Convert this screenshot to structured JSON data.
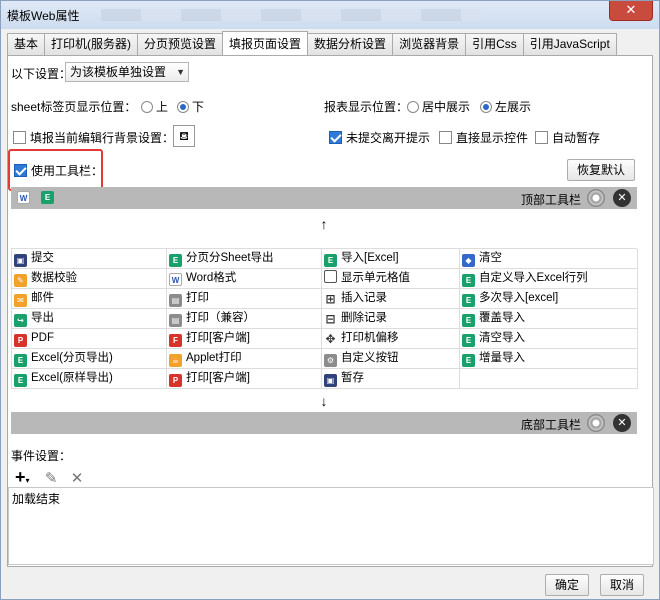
{
  "window": {
    "title": "模板Web属性",
    "close_label": "✕"
  },
  "tabs": [
    "基本",
    "打印机(服务器)",
    "分页预览设置",
    "填报页面设置",
    "数据分析设置",
    "浏览器背景",
    "引用Css",
    "引用JavaScript"
  ],
  "settings": {
    "scope_label": "以下设置：",
    "scope_value": "为该模板单独设置",
    "sheet_pos_label": "sheet标签页显示位置：",
    "sheet_top": "上",
    "sheet_bottom": "下",
    "report_pos_label": "报表显示位置：",
    "report_center": "居中展示",
    "report_left": "左展示",
    "fill_bg_label": "填报当前编辑行背景设置：",
    "unsaved_prompt": "未提交离开提示",
    "show_controls": "直接显示控件",
    "auto_save": "自动暂存",
    "use_toolbar": "使用工具栏：",
    "restore_default": "恢复默认"
  },
  "top_toolbar": {
    "label": "顶部工具栏"
  },
  "bottom_toolbar": {
    "label": "底部工具栏"
  },
  "buttons": [
    {
      "label": "提交",
      "icon": "save-icon",
      "c": "navy",
      "g": "▣"
    },
    {
      "label": "分页分Sheet导出",
      "icon": "excel-icon",
      "c": "green",
      "g": "E"
    },
    {
      "label": "导入[Excel]",
      "icon": "excel-icon",
      "c": "green",
      "g": "E"
    },
    {
      "label": "清空",
      "icon": "eraser-icon",
      "c": "blue",
      "g": "◆"
    },
    {
      "label": "数据校验",
      "icon": "pencil-icon",
      "c": "orange",
      "g": "✎"
    },
    {
      "label": "Word格式",
      "icon": "word-icon",
      "c": "word",
      "g": "W"
    },
    {
      "label": "显示单元格值",
      "icon": "cell-icon",
      "c": "outline",
      "g": ""
    },
    {
      "label": "自定义导入Excel行列",
      "icon": "excel-icon",
      "c": "green",
      "g": "E"
    },
    {
      "label": "邮件",
      "icon": "mail-icon",
      "c": "orange",
      "g": "✉"
    },
    {
      "label": "打印",
      "icon": "printer-icon",
      "c": "gray",
      "g": "▤"
    },
    {
      "label": "插入记录",
      "icon": "insert-row-icon",
      "c": "glyph",
      "g": "⊞"
    },
    {
      "label": "多次导入[excel]",
      "icon": "excel-icon",
      "c": "green",
      "g": "E"
    },
    {
      "label": "导出",
      "icon": "export-icon",
      "c": "green",
      "g": "↪"
    },
    {
      "label": "打印（兼容）",
      "icon": "printer-icon",
      "c": "gray",
      "g": "▤"
    },
    {
      "label": "删除记录",
      "icon": "delete-row-icon",
      "c": "glyph",
      "g": "⊟"
    },
    {
      "label": "覆盖导入",
      "icon": "excel-icon",
      "c": "green",
      "g": "E"
    },
    {
      "label": "PDF",
      "icon": "pdf-icon",
      "c": "red",
      "g": "P"
    },
    {
      "label": "打印[客户端]",
      "icon": "flash-print-icon",
      "c": "red",
      "g": "F"
    },
    {
      "label": "打印机偏移",
      "icon": "move-icon",
      "c": "glyph",
      "g": "✥"
    },
    {
      "label": "清空导入",
      "icon": "excel-icon",
      "c": "green",
      "g": "E"
    },
    {
      "label": "Excel(分页导出)",
      "icon": "excel-icon",
      "c": "green",
      "g": "E"
    },
    {
      "label": "Applet打印",
      "icon": "applet-icon",
      "c": "orange",
      "g": "☕"
    },
    {
      "label": "自定义按钮",
      "icon": "gear-icon",
      "c": "gray",
      "g": "⚙"
    },
    {
      "label": "增量导入",
      "icon": "excel-icon",
      "c": "green",
      "g": "E"
    },
    {
      "label": "Excel(原样导出)",
      "icon": "excel-icon",
      "c": "green",
      "g": "E"
    },
    {
      "label": "打印[客户端]",
      "icon": "pdf-print-icon",
      "c": "red",
      "g": "P"
    },
    {
      "label": "暂存",
      "icon": "save-temp-icon",
      "c": "navy",
      "g": "▣"
    },
    {
      "label": "",
      "icon": "",
      "c": "",
      "g": ""
    }
  ],
  "events": {
    "label": "事件设置：",
    "items": [
      "加载结束"
    ]
  },
  "footer": {
    "ok": "确定",
    "cancel": "取消"
  }
}
